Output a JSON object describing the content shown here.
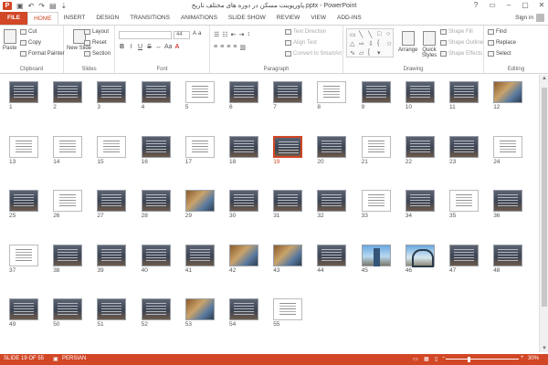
{
  "titlebar": {
    "title": "پاورپوینت مسکن در دوره های مختلف تاریخ.pptx - PowerPoint",
    "app_icon": "P",
    "qat_icons": [
      "save-icon",
      "undo-icon",
      "redo-icon",
      "start-from-beginning-icon",
      "customize-icon"
    ],
    "controls": [
      "?",
      "▭",
      "–",
      "▢",
      "✕"
    ]
  },
  "tabs": [
    "FILE",
    "HOME",
    "INSERT",
    "DESIGN",
    "TRANSITIONS",
    "ANIMATIONS",
    "SLIDE SHOW",
    "REVIEW",
    "VIEW",
    "ADD-INS"
  ],
  "active_tab": "HOME",
  "signin": "Sign in",
  "ribbon": {
    "clipboard": {
      "label": "Clipboard",
      "paste": "Paste",
      "cut": "Cut",
      "copy": "Copy",
      "format_painter": "Format Painter"
    },
    "slides": {
      "label": "Slides",
      "new_slide": "New Slide",
      "layout": "Layout",
      "reset": "Reset",
      "section": "Section"
    },
    "font": {
      "label": "Font",
      "size": "44"
    },
    "paragraph": {
      "label": "Paragraph",
      "text_direction": "Text Direction",
      "align_text": "Align Text",
      "convert_smartart": "Convert to SmartArt"
    },
    "drawing": {
      "label": "Drawing",
      "arrange": "Arrange",
      "quick_styles": "Quick Styles",
      "shape_fill": "Shape Fill",
      "shape_outline": "Shape Outline",
      "shape_effects": "Shape Effects"
    },
    "editing": {
      "label": "Editing",
      "find": "Find",
      "replace": "Replace",
      "select": "Select"
    }
  },
  "slides": [
    {
      "n": "1",
      "k": "d"
    },
    {
      "n": "2",
      "k": "d"
    },
    {
      "n": "3",
      "k": "d"
    },
    {
      "n": "4",
      "k": "d"
    },
    {
      "n": "5",
      "k": "w"
    },
    {
      "n": "6",
      "k": "d"
    },
    {
      "n": "7",
      "k": "d"
    },
    {
      "n": "8",
      "k": "w"
    },
    {
      "n": "9",
      "k": "d"
    },
    {
      "n": "10",
      "k": "d"
    },
    {
      "n": "11",
      "k": "d"
    },
    {
      "n": "12",
      "k": "p"
    },
    {
      "n": "13",
      "k": "w"
    },
    {
      "n": "14",
      "k": "w"
    },
    {
      "n": "15",
      "k": "w"
    },
    {
      "n": "16",
      "k": "d"
    },
    {
      "n": "17",
      "k": "w"
    },
    {
      "n": "18",
      "k": "d"
    },
    {
      "n": "19",
      "k": "d"
    },
    {
      "n": "20",
      "k": "d"
    },
    {
      "n": "21",
      "k": "w"
    },
    {
      "n": "22",
      "k": "d"
    },
    {
      "n": "23",
      "k": "d"
    },
    {
      "n": "24",
      "k": "w"
    },
    {
      "n": "25",
      "k": "d"
    },
    {
      "n": "26",
      "k": "w"
    },
    {
      "n": "27",
      "k": "d"
    },
    {
      "n": "28",
      "k": "d"
    },
    {
      "n": "29",
      "k": "p"
    },
    {
      "n": "30",
      "k": "d"
    },
    {
      "n": "31",
      "k": "d"
    },
    {
      "n": "32",
      "k": "d"
    },
    {
      "n": "33",
      "k": "w"
    },
    {
      "n": "34",
      "k": "d"
    },
    {
      "n": "35",
      "k": "w"
    },
    {
      "n": "36",
      "k": "d"
    },
    {
      "n": "37",
      "k": "w"
    },
    {
      "n": "38",
      "k": "d"
    },
    {
      "n": "39",
      "k": "d"
    },
    {
      "n": "40",
      "k": "d"
    },
    {
      "n": "41",
      "k": "d"
    },
    {
      "n": "42",
      "k": "p"
    },
    {
      "n": "43",
      "k": "p"
    },
    {
      "n": "44",
      "k": "d"
    },
    {
      "n": "45",
      "k": "s"
    },
    {
      "n": "46",
      "k": "a"
    },
    {
      "n": "47",
      "k": "d"
    },
    {
      "n": "48",
      "k": "d"
    },
    {
      "n": "49",
      "k": "d"
    },
    {
      "n": "50",
      "k": "d"
    },
    {
      "n": "51",
      "k": "d"
    },
    {
      "n": "52",
      "k": "d"
    },
    {
      "n": "53",
      "k": "p"
    },
    {
      "n": "54",
      "k": "d"
    },
    {
      "n": "55",
      "k": "w"
    }
  ],
  "selected_slide": "19",
  "status": {
    "slide_info": "SLIDE 19 OF 55",
    "language": "PERSIAN",
    "zoom": "30%",
    "zoom_level": 0.3
  },
  "colors": {
    "accent": "#d24726"
  }
}
